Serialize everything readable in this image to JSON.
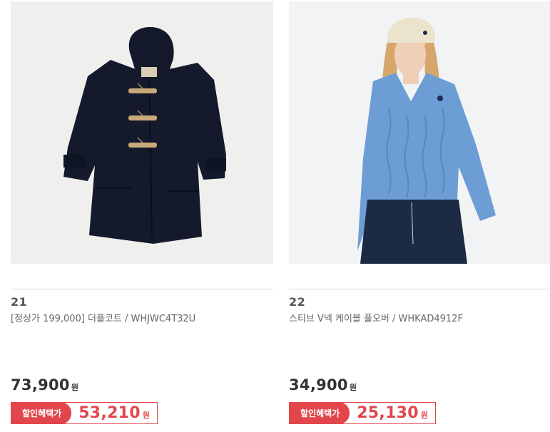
{
  "products": [
    {
      "number": "21",
      "name": "[정상가 199,000] 더플코트 / WHJWC4T32U",
      "price": "73,900",
      "currency": "원",
      "sale_label": "할인혜택가",
      "sale_price": "53,210",
      "image": "navy-duffle-coat-image"
    },
    {
      "number": "22",
      "name": "스티브 V넥 케이블 풀오버 / WHKAD4912F",
      "price": "34,900",
      "currency": "원",
      "sale_label": "할인혜택가",
      "sale_price": "25,130",
      "image": "model-blue-cable-knit-pullover-image"
    }
  ],
  "colors": {
    "accent": "#e2464c",
    "price_text": "#333333",
    "divider": "#dcdcdc"
  }
}
